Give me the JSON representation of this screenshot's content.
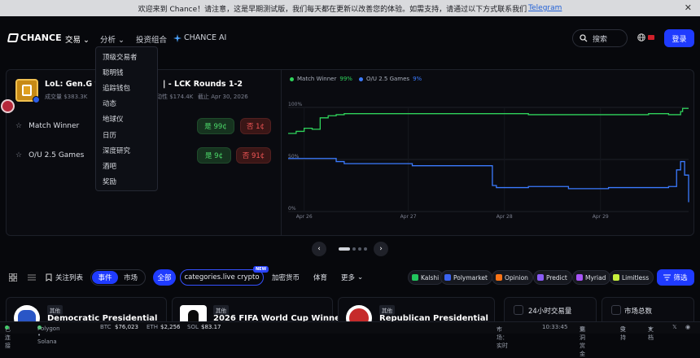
{
  "banner": {
    "text": "欢迎来到 Chance！请注意，这是早期测试版，我们每天都在更新以改善您的体验。如需支持，请通过以下方式联系我们",
    "link": "Telegram",
    "close": "✕"
  },
  "nav": {
    "logo": "CHANCE",
    "items": [
      {
        "label": "交易",
        "chevron": "⌄"
      },
      {
        "label": "分析",
        "chevron": "⌄"
      },
      {
        "label": "投资组合"
      },
      {
        "label": "CHANCE AI"
      }
    ],
    "search_label": "搜索",
    "login": "登录"
  },
  "analysis_menu": [
    "顶级交易者",
    "聪明钱",
    "追踪钱包",
    "动态",
    "地球仪",
    "日历",
    "深度研究",
    "酒吧",
    "奖励"
  ],
  "featured": {
    "title_left": "LoL: Gen.G vs K",
    "title_right": "| - LCK Rounds 1-2",
    "volume": "成交量 $383.3K",
    "liquidity": "流动性 $174.4K",
    "end_date": "截止 Apr 30, 2026",
    "markets": [
      {
        "name": "Match Winner",
        "yes": "是 99¢",
        "no": "否 1¢"
      },
      {
        "name": "O/U 2.5 Games",
        "yes": "是 9¢",
        "no": "否 91¢"
      }
    ],
    "legend": [
      {
        "name": "Match Winner",
        "value": "99%",
        "color": "#2fd35b"
      },
      {
        "name": "O/U 2.5 Games",
        "value": "9%",
        "color": "#3b7bff"
      }
    ]
  },
  "chart_data": {
    "type": "line",
    "x_ticks": [
      "Apr 26",
      "Apr 27",
      "Apr 28",
      "Apr 29"
    ],
    "y_ticks": [
      "100%",
      "50%",
      "0%"
    ],
    "ylim": [
      0,
      100
    ],
    "series": [
      {
        "name": "Match Winner",
        "color": "#2fd35b",
        "x": [
          0,
          0.02,
          0.04,
          0.06,
          0.08,
          0.1,
          0.12,
          0.14,
          0.16,
          0.3,
          0.45,
          0.6,
          0.75,
          0.9,
          0.95,
          0.98,
          0.985,
          1.0
        ],
        "values": [
          75,
          77,
          80,
          79,
          90,
          92,
          93,
          94,
          94,
          94,
          94,
          93,
          93,
          94,
          93,
          96,
          99,
          99
        ]
      },
      {
        "name": "O/U 2.5 Games",
        "color": "#3b7bff",
        "x": [
          0,
          0.1,
          0.12,
          0.14,
          0.3,
          0.31,
          0.4,
          0.5,
          0.51,
          0.52,
          0.6,
          0.7,
          0.8,
          0.9,
          0.95,
          0.97,
          0.98,
          0.99,
          1.0
        ],
        "values": [
          51,
          51,
          48,
          46,
          46,
          44,
          44,
          44,
          25,
          23,
          24,
          22,
          23,
          23,
          24,
          40,
          48,
          35,
          9
        ]
      }
    ]
  },
  "filters": {
    "watchlist": "关注列表",
    "seg_on": "事件",
    "seg_off": "市场",
    "all": "全部",
    "crypto": "categories.live crypto",
    "new": "NEW",
    "cats": [
      "加密货币",
      "体育",
      "更多"
    ],
    "more_chevron": "⌄",
    "sources": [
      {
        "name": "Kalshi",
        "color": "#22c55e"
      },
      {
        "name": "Polymarket",
        "color": "#3b63f0"
      },
      {
        "name": "Opinion",
        "color": "#f97316"
      },
      {
        "name": "Predict",
        "color": "#8b5cf6"
      },
      {
        "name": "Myriad",
        "color": "#a855f7"
      },
      {
        "name": "Limitless",
        "color": "#c7f03c"
      }
    ],
    "filter_button": "筛选"
  },
  "market_cards": [
    {
      "tag": "其他",
      "title": "Democratic Presidential"
    },
    {
      "tag": "其他",
      "title": "2026 FIFA World Cup Winner"
    },
    {
      "tag": "其他",
      "title": "Republican Presidential"
    }
  ],
  "stats": {
    "volume_24h": "24小时交易量",
    "market_total": "市场总数"
  },
  "footer": {
    "connected": "已连接",
    "network": "Polygon • Solana",
    "btc_label": "BTC",
    "btc": "$76,023",
    "eth_label": "ETH",
    "eth": "$2,256",
    "sol_label": "SOL",
    "sol": "$83.17",
    "market": "市场：实时",
    "time": "10:33:45",
    "bounty": "漏洞赏金",
    "support": "支持",
    "docs": "文档"
  }
}
